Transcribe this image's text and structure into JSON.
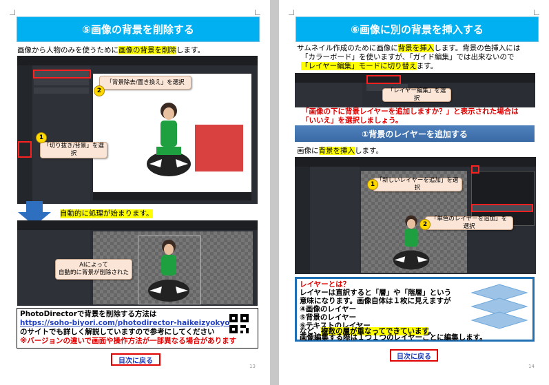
{
  "left": {
    "title": "⑤画像の背景を削除する",
    "intro_pre": "画像から人物のみを使うために",
    "intro_hl": "画像の背景を削除",
    "intro_post": "します。",
    "callout1": "「切り抜き/背景」を選択",
    "callout2": "「背景除去/置き換え」を選択",
    "auto_text": "自動的に処理が始まります。",
    "ai_callout": "AIによって\n自動的に背景が削除された",
    "info_line1": "PhotoDirectorで背景を削除する方法は",
    "info_url": "https://soho-biyori.com/photodirector-haikeizyokyo",
    "info_line3": "のサイトでも詳しく解説していますので参考にしてください",
    "info_warning": "※バージョンの違いで画面や操作方法が一部異なる場合があります",
    "back_link": "目次に戻る",
    "page_number": "13"
  },
  "right": {
    "title": "⑥画像に別の背景を挿入する",
    "intro_line1_pre": "サムネイル作成のために画像に",
    "intro_line1_hl": "背景を挿入",
    "intro_line1_post": "します。背景の色挿入には",
    "intro_line2": "「カラーボード」を使いますが、「ガイド編集」では出来ないので",
    "intro_line3_hl": "「レイヤー編集」モードに切り替え",
    "intro_line3_post": "ます。",
    "callout_layer": "「レイヤー編集」を選択",
    "red_note1": "「画像の下に背景レイヤーを追加しますか？」と表示された場合は",
    "red_note2": "「いいえ」を選択しましょう。",
    "section_banner": "①背景のレイヤーを追加する",
    "insert_pre": "画像に",
    "insert_hl": "背景を挿入",
    "insert_post": "します。",
    "callout_new_layer": "「新しいレイヤーを追加」を選択",
    "callout_solid_layer": "「単色のレイヤーを追加」を選択",
    "layer_box_title": "レイヤーとは？",
    "layer_box_line1": "レイヤーは直訳すると「層」や「階層」という",
    "layer_box_line2": "意味になります。画像自体は１枚に見えますが",
    "layer_box_item4": "④画像のレイヤー",
    "layer_box_item5": "⑤背景のレイヤー",
    "layer_box_item6": "⑥テキストのレイヤー",
    "layer_box_line6_pre": "など、",
    "layer_box_line6_hl": "複数の層が重なってできています",
    "layer_box_line6_post": "。",
    "layer_box_line7": "画像編集する際は１つ１つのレイヤーごとに編集します。",
    "back_link": "目次に戻る",
    "page_number": "14"
  },
  "colors": {
    "title_bg": "#00b0f0",
    "highlight": "#ffff00",
    "red_text": "#e00000",
    "banner_blue": "#4f81bd",
    "box_border_blue": "#1f6fb5"
  }
}
